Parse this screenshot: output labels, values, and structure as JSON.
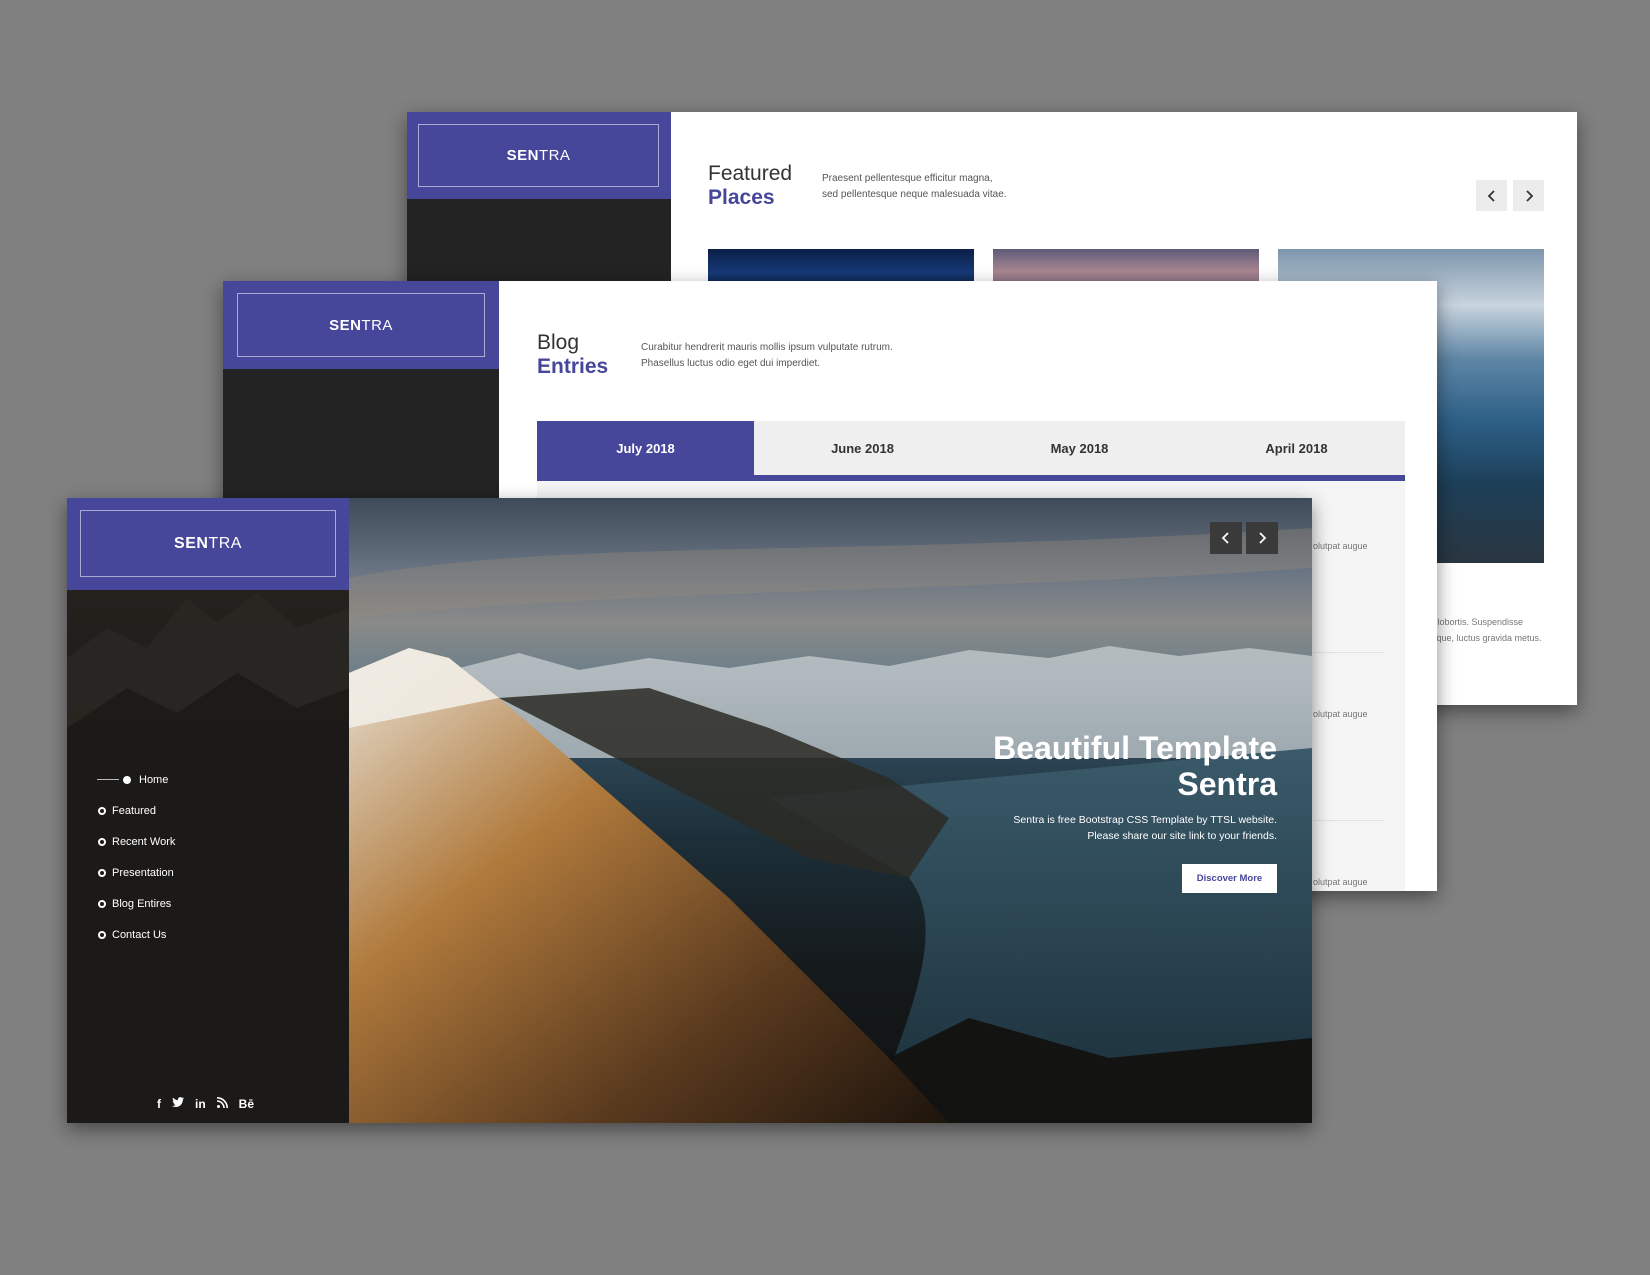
{
  "featured_screen": {
    "logo": {
      "bold": "SEN",
      "light": "TRA"
    },
    "title_line1": "Featured",
    "title_line2": "Places",
    "desc_line1": "Praesent pellentesque efficitur magna,",
    "desc_line2": "sed pellentesque neque malesuada vitae.",
    "prev_icon": "chevron-left-icon",
    "next_icon": "chevron-right-icon",
    "caption_line1": "r lobortis. Suspendisse",
    "caption_line2": "tique, luctus gravida metus."
  },
  "blog_screen": {
    "logo": {
      "bold": "SEN",
      "light": "TRA"
    },
    "title_line1": "Blog",
    "title_line2": "Entries",
    "desc_line1": "Curabitur hendrerit mauris mollis ipsum vulputate rutrum.",
    "desc_line2": "Phasellus luctus odio eget dui imperdiet.",
    "tabs": [
      "July 2018",
      "June 2018",
      "May 2018",
      "April 2018"
    ],
    "active_tab": "July 2018",
    "fragment": "olutpat augue"
  },
  "home_screen": {
    "logo": {
      "bold": "SEN",
      "light": "TRA"
    },
    "nav": [
      "Home",
      "Featured",
      "Recent Work",
      "Presentation",
      "Blog Entires",
      "Contact Us"
    ],
    "active_nav": "Home",
    "hero_title_line1": "Beautiful Template",
    "hero_title_line2": "Sentra",
    "hero_sub_line1": "Sentra is free Bootstrap CSS Template by TTSL website.",
    "hero_sub_line2": "Please share our site link to your friends.",
    "cta_label": "Discover More",
    "social": [
      "f",
      "🐦",
      "in",
      "rss",
      "Bē"
    ],
    "social_icons": [
      "facebook-icon",
      "twitter-icon",
      "linkedin-icon",
      "rss-icon",
      "behance-icon"
    ]
  },
  "colors": {
    "accent": "#46469a",
    "backdrop": "#808080",
    "sidebar": "#232323"
  }
}
